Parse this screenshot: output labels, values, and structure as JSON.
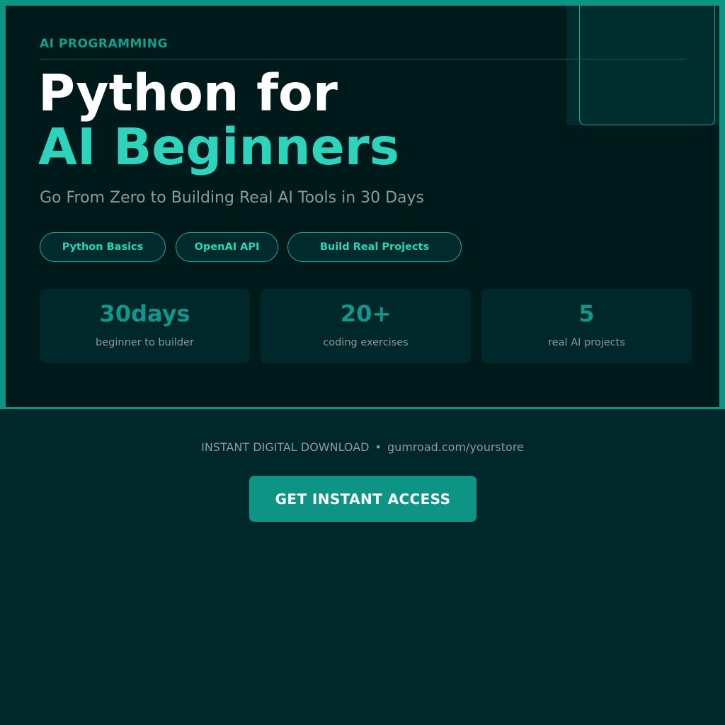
{
  "hero": {
    "eyebrow": "AI PROGRAMMING",
    "title_line_1": "Python for",
    "title_line_2": "AI Beginners",
    "subtitle": "Go From Zero to Building Real AI Tools in 30 Days",
    "tags": [
      "Python Basics",
      "OpenAI API",
      "Build Real Projects"
    ],
    "stats": [
      {
        "value": "30days",
        "label": "beginner to builder"
      },
      {
        "value": "20+",
        "label": "coding exercises"
      },
      {
        "value": "5",
        "label": "real AI projects"
      }
    ]
  },
  "footer": {
    "delivery": "INSTANT DIGITAL DOWNLOAD",
    "separator": "•",
    "store_url": "gumroad.com/yourstore",
    "cta_label": "GET INSTANT ACCESS"
  },
  "colors": {
    "accent": "#0e9484",
    "accent_light": "#2ed3bb",
    "background": "#00191a",
    "panel": "#00272a",
    "muted_text": "#8d9a9a"
  }
}
